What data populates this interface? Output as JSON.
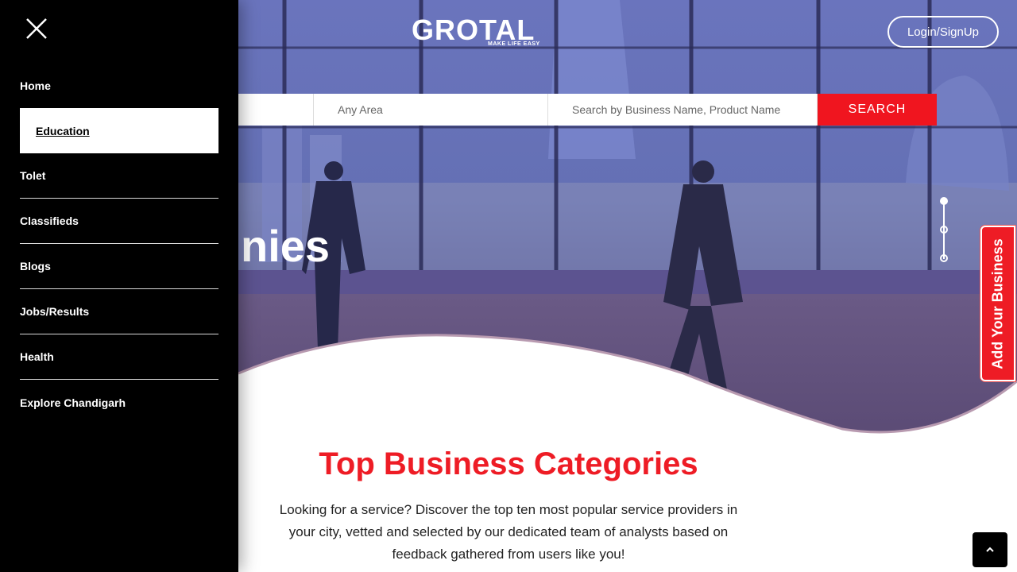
{
  "sidebar": {
    "close_icon": "close-icon",
    "items": [
      {
        "label": "Home"
      },
      {
        "label": "Education"
      },
      {
        "label": "Tolet"
      },
      {
        "label": "Classifieds"
      },
      {
        "label": "Blogs"
      },
      {
        "label": "Jobs/Results"
      },
      {
        "label": "Health"
      },
      {
        "label": "Explore Chandigarh"
      }
    ],
    "active_item": "Education"
  },
  "header": {
    "logo_text": "GROTAL",
    "logo_tagline": "MAKE LIFE EASY",
    "login_label": "Login/SignUp"
  },
  "search": {
    "area_placeholder": "Any Area",
    "query_placeholder": "Search by Business Name, Product Name",
    "button_label": "SEARCH"
  },
  "hero": {
    "heading_visible": "nies",
    "slide_count": 3,
    "active_slide": 1
  },
  "add_business": {
    "label": "Add Your Business"
  },
  "categories_section": {
    "title": "Top Business Categories",
    "description": "Looking for a service? Discover the top ten most popular service providers in your city, vetted and selected by our dedicated team of analysts based on feedback gathered from users like you!"
  },
  "scroll_top_icon": "chevron-up-icon",
  "colors": {
    "accent_red": "#ee1c25",
    "sidebar_bg": "#000000",
    "hero_overlay": "#4a55a8"
  }
}
